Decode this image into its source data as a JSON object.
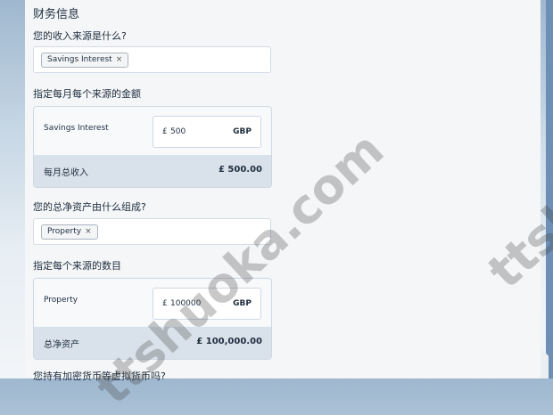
{
  "section": {
    "title": "财务信息"
  },
  "income": {
    "question": "您的收入来源是什么?",
    "tags": [
      {
        "label": "Savings Interest",
        "remove": "×"
      }
    ],
    "amount_question": "指定每月每个来源的金额",
    "sources": [
      {
        "label": "Savings Interest",
        "currency_symbol": "£",
        "value": "500",
        "currency_code": "GBP"
      }
    ],
    "total_label": "每月总收入",
    "total_value": "£ 500.00"
  },
  "assets": {
    "question": "您的总净资产由什么组成?",
    "tags": [
      {
        "label": "Property",
        "remove": "×"
      }
    ],
    "amount_question": "指定每个来源的数目",
    "sources": [
      {
        "label": "Property",
        "currency_symbol": "£",
        "value": "100000",
        "currency_code": "GBP"
      }
    ],
    "total_label": "总净资产",
    "total_value": "£ 100,000.00"
  },
  "crypto": {
    "question": "您持有加密货币等虚拟货币吗?"
  },
  "watermarks": {
    "text1": "ttshuoka.com",
    "text2": "ttsh"
  }
}
